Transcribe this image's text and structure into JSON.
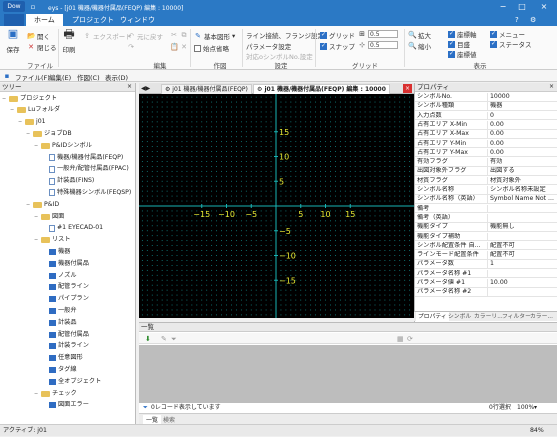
{
  "titlebar": {
    "app": "Dow",
    "title": "eys - [j01 機器/機器付属品(FEQP) 編集 : 10000]"
  },
  "tabs": [
    "ホーム",
    "プロジェクト",
    "ウィンドウ"
  ],
  "ribbon": {
    "save": "保存",
    "open": "開く",
    "close": "閉じる",
    "group_file": "ファイル",
    "print": "印刷",
    "export": "エクスポート",
    "undo": "元に戻す",
    "group_edit": "編集",
    "basic_shape": "基本図形",
    "start_point": "始点省略",
    "group_draw": "作図",
    "line_conn": "ライン接続、フランジ設定",
    "param": "パラメータ設定",
    "obj_no": "対応oシンボルNo.設定",
    "group_setting": "設定",
    "grid": "グリッド",
    "snap": "スナップ",
    "grid_v1": "0.5",
    "grid_v2": "0.5",
    "group_grid": "グリッド",
    "zoom_in": "拡大",
    "zoom_out": "縮小",
    "coord_axis": "座標軸",
    "back_grid": "目盛",
    "coord_val": "座標値",
    "menu": "メニュー",
    "status": "ステータス",
    "group_view": "表示"
  },
  "toolbar2": [
    "ファイル(F)",
    "編集(E)",
    "作図(C)",
    "表示(D)"
  ],
  "tree": {
    "title": "ツリー",
    "nodes": [
      {
        "label": "プロジェクト",
        "indent": 0,
        "icon": "folder",
        "tog": "−"
      },
      {
        "label": "Luフォルダ",
        "indent": 1,
        "icon": "folder",
        "tog": "−"
      },
      {
        "label": "j01",
        "indent": 2,
        "icon": "folder",
        "tog": "−"
      },
      {
        "label": "ジョブDB",
        "indent": 3,
        "icon": "folder",
        "tog": "−"
      },
      {
        "label": "P&IDシンボル",
        "indent": 4,
        "icon": "folder",
        "tog": "−"
      },
      {
        "label": "機器/機器付属品(FEQP)",
        "indent": 5,
        "icon": "doc"
      },
      {
        "label": "一般弁/配管付属品(FPAC)",
        "indent": 5,
        "icon": "doc"
      },
      {
        "label": "計装品(FINS)",
        "indent": 5,
        "icon": "doc"
      },
      {
        "label": "特殊機器シンボル(FEQSP)",
        "indent": 5,
        "icon": "doc"
      },
      {
        "label": "P&ID",
        "indent": 3,
        "icon": "folder",
        "tog": "−"
      },
      {
        "label": "図面",
        "indent": 4,
        "icon": "folder",
        "tog": "−"
      },
      {
        "label": "#1 EYECAD-01",
        "indent": 5,
        "icon": "doc"
      },
      {
        "label": "リスト",
        "indent": 4,
        "icon": "folder",
        "tog": "−"
      },
      {
        "label": "機器",
        "indent": 5,
        "icon": "grid"
      },
      {
        "label": "機器付属品",
        "indent": 5,
        "icon": "grid"
      },
      {
        "label": "ノズル",
        "indent": 5,
        "icon": "grid"
      },
      {
        "label": "配管ライン",
        "indent": 5,
        "icon": "grid"
      },
      {
        "label": "パイプラン",
        "indent": 5,
        "icon": "grid"
      },
      {
        "label": "一般弁",
        "indent": 5,
        "icon": "grid"
      },
      {
        "label": "計装品",
        "indent": 5,
        "icon": "grid"
      },
      {
        "label": "配管付属品",
        "indent": 5,
        "icon": "grid"
      },
      {
        "label": "計装ライン",
        "indent": 5,
        "icon": "grid"
      },
      {
        "label": "任意図形",
        "indent": 5,
        "icon": "grid"
      },
      {
        "label": "タグ線",
        "indent": 5,
        "icon": "grid"
      },
      {
        "label": "全オブジェクト",
        "indent": 5,
        "icon": "grid"
      },
      {
        "label": "チェック",
        "indent": 4,
        "icon": "folder",
        "tog": "−"
      },
      {
        "label": "図面エラー",
        "indent": 5,
        "icon": "grid"
      }
    ]
  },
  "doctabs": [
    {
      "label": "j01 機器/機器付属品(FEQP)",
      "active": false
    },
    {
      "label": "j01 機器/機器付属品(FEQP) 編集 : 10000",
      "active": true
    }
  ],
  "canvas": {
    "x_ticks": [
      "−15",
      "−10",
      "−5",
      "0",
      "5",
      "10",
      "15"
    ],
    "y_ticks": [
      "15",
      "10",
      "5",
      "0",
      "−5",
      "−10",
      "−15"
    ]
  },
  "props": {
    "title": "プロパティ",
    "rows": [
      [
        "シンボルNo.",
        "10000"
      ],
      [
        "シンボル種類",
        "機器"
      ],
      [
        "入力点数",
        "0"
      ],
      [
        "占有エリア X-Min",
        "0.00"
      ],
      [
        "占有エリア X-Max",
        "0.00"
      ],
      [
        "占有エリア Y-Min",
        "0.00"
      ],
      [
        "占有エリア Y-Max",
        "0.00"
      ],
      [
        "有効フラグ",
        "有効"
      ],
      [
        "出図対象外フラグ",
        "出図する"
      ],
      [
        "材質フラグ",
        "材質対象外"
      ],
      [
        "シンボル名称",
        "シンボル名称未設定"
      ],
      [
        "シンボル名称（英語）",
        "Symbol Name Not ..."
      ],
      [
        "備考",
        ""
      ],
      [
        "備考（英語）",
        ""
      ],
      [
        "機能タイプ",
        "機能無し"
      ],
      [
        "機能タイプ補助",
        ""
      ],
      [
        "シンボル配置条件 自...",
        "配置不可"
      ],
      [
        "ラインモード配置条件",
        "配置不可"
      ],
      [
        "パラメータ数",
        "1"
      ],
      [
        "パラメータ名称 #1",
        ""
      ],
      [
        "パラメータ値 #1",
        "10.00"
      ],
      [
        "パラメータ名称 #2",
        ""
      ]
    ],
    "tabs": [
      "プロパティ",
      "シンボル",
      "カラーリ...",
      "フィルター",
      "カラー..."
    ]
  },
  "list": {
    "title": "一覧",
    "status_text": "0レコード表示しています",
    "selected": "0行選択",
    "zoom": "100%",
    "tabs": [
      "一覧",
      "検索"
    ]
  },
  "statusbar": {
    "left": "アクティブ: j01",
    "right": "84%"
  }
}
